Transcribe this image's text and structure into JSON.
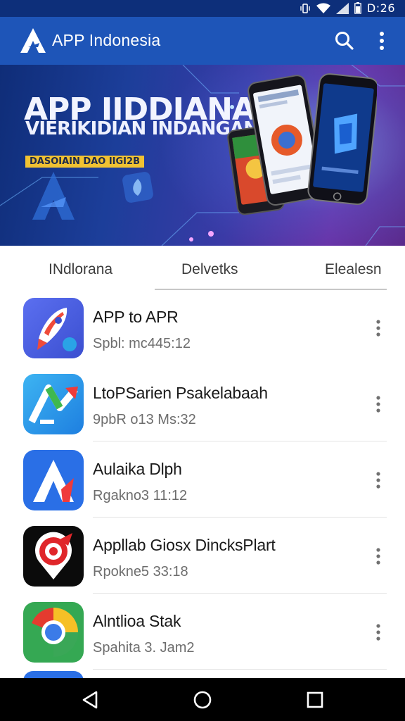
{
  "status_bar": {
    "time": "D:26"
  },
  "app_bar": {
    "title": "APP Indonesia"
  },
  "banner": {
    "headline": "APP IIDDIANA",
    "subheadline": "VIERIKIDIAN INDANGAN",
    "tag": "DASOIAIN DAO IIGI2B"
  },
  "tabs": [
    {
      "label": "INdlorana"
    },
    {
      "label": "Delvetks",
      "selected": true
    },
    {
      "label": "Elealesn"
    }
  ],
  "apps": [
    {
      "name": "APP to APR",
      "meta": "Spbl: mc445:12",
      "icon": "rocket-app-icon"
    },
    {
      "name": "LtoPSarien Psakelabaah",
      "meta": "9pbR o13 Ms:32",
      "icon": "arrow-chart-app-icon"
    },
    {
      "name": "Aulaika Dlph",
      "meta": "Rgakno3 11:12",
      "icon": "letter-a-app-icon"
    },
    {
      "name": "Appllab Giosx DincksPlart",
      "meta": "Rpokne5 33:18",
      "icon": "target-pin-app-icon"
    },
    {
      "name": "Alntlioa Stak",
      "meta": "Spahita 3. Jam2",
      "icon": "chrome-app-icon"
    }
  ],
  "colors": {
    "app_bar": "#1e55b8",
    "status_bar": "#0d2f7a",
    "nav_bar": "#000000"
  }
}
